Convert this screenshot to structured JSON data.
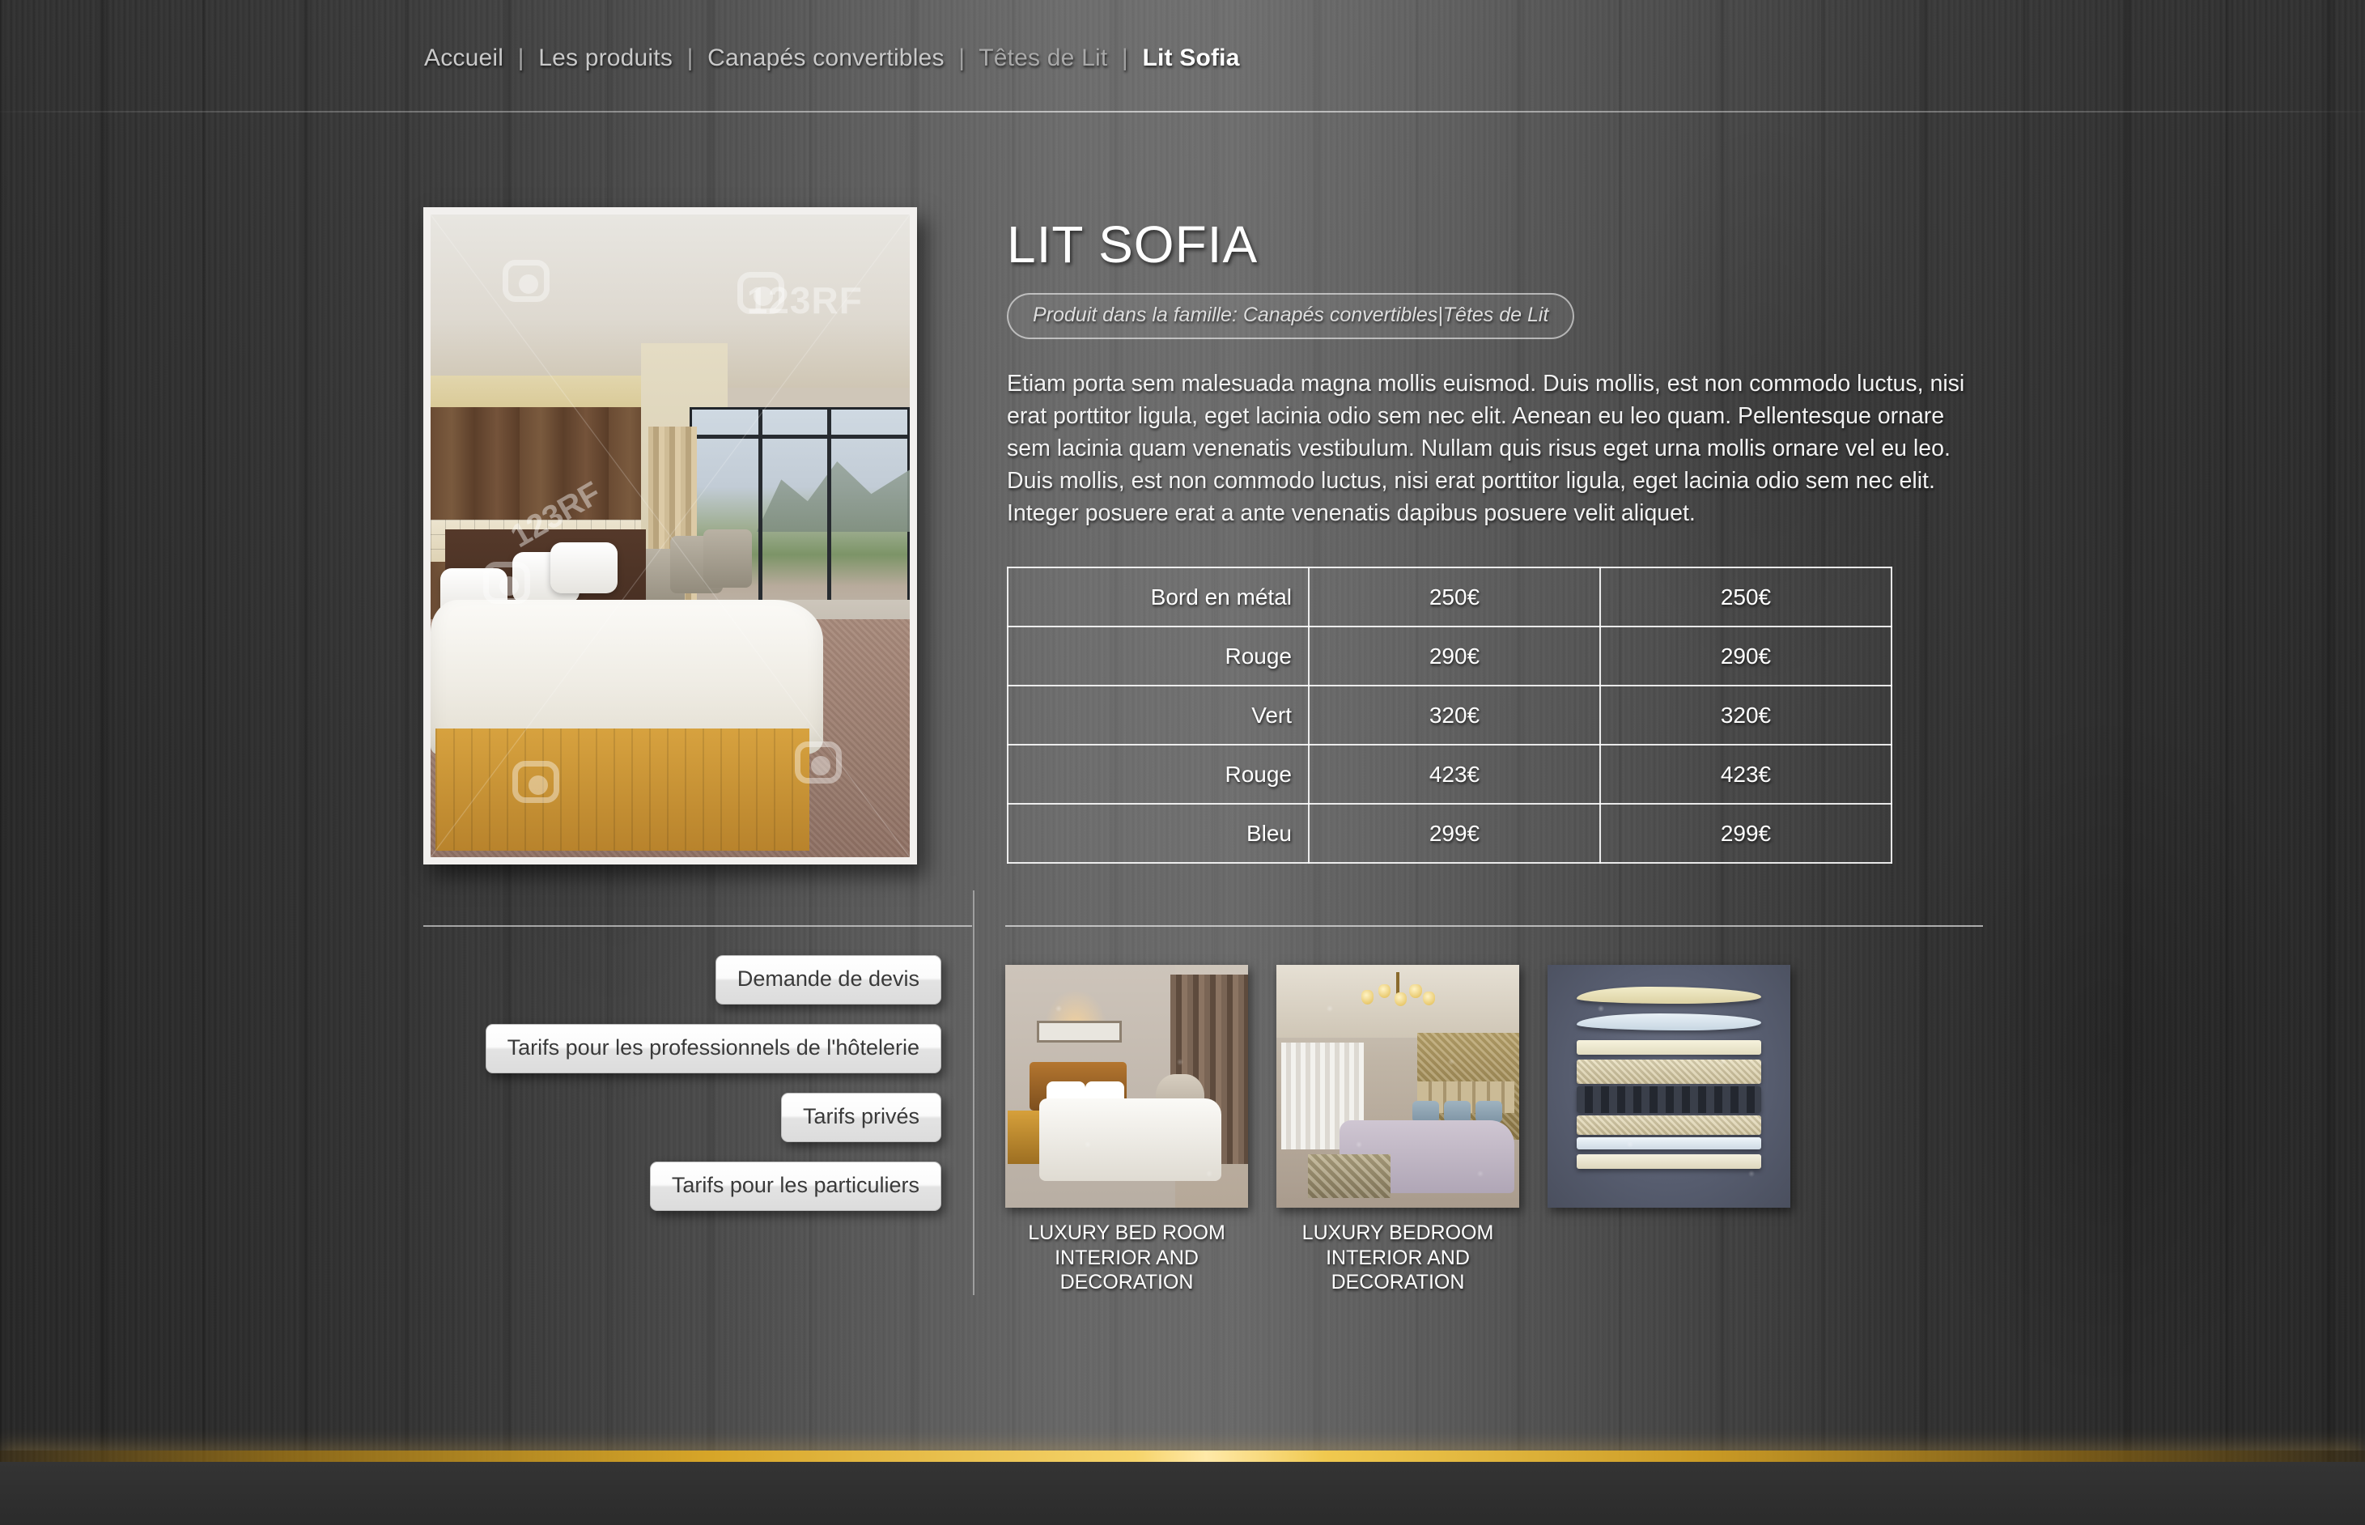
{
  "breadcrumb": {
    "items": [
      {
        "label": "Accueil",
        "current": false
      },
      {
        "label": "Les produits",
        "current": false
      },
      {
        "label": "Canapés convertibles",
        "current": false
      },
      {
        "label": "Têtes de Lit",
        "current": false
      },
      {
        "label": "Lit Sofia",
        "current": true
      }
    ],
    "separator": "|"
  },
  "product": {
    "title": "LIT SOFIA",
    "family_badge": "Produit dans la famille: Canapés convertibles|Têtes de Lit",
    "description": "Etiam porta sem malesuada magna mollis euismod. Duis mollis, est non commodo luctus, nisi erat porttitor ligula, eget lacinia odio sem nec elit. Aenean eu leo quam. Pellentesque ornare sem lacinia quam venenatis vestibulum. Nullam quis risus eget urna mollis ornare vel eu leo. Duis mollis, est non commodo luctus, nisi erat porttitor ligula, eget lacinia odio sem nec elit. Integer posuere erat a ante venenatis dapibus posuere velit aliquet.",
    "hero_image": {
      "name": "hotel-bedroom-photo",
      "watermark": "123RF"
    }
  },
  "price_table": {
    "rows": [
      {
        "label": "Bord en métal",
        "price_a": "250€",
        "price_b": "250€"
      },
      {
        "label": "Rouge",
        "price_a": "290€",
        "price_b": "290€"
      },
      {
        "label": "Vert",
        "price_a": "320€",
        "price_b": "320€"
      },
      {
        "label": "Rouge",
        "price_a": "423€",
        "price_b": "423€"
      },
      {
        "label": "Bleu",
        "price_a": "299€",
        "price_b": "299€"
      }
    ]
  },
  "cta_buttons": [
    {
      "label": "Demande de devis"
    },
    {
      "label": "Tarifs pour les professionnels de l'hôtelerie"
    },
    {
      "label": "Tarifs privés"
    },
    {
      "label": "Tarifs pour les particuliers"
    }
  ],
  "gallery": [
    {
      "caption": "LUXURY BED ROOM INTERIOR AND DECORATION",
      "image_name": "luxury-bed-room-thumbnail"
    },
    {
      "caption": "LUXURY BEDROOM INTERIOR AND DECORATION",
      "image_name": "luxury-bedroom-chandelier-thumbnail"
    },
    {
      "caption": "",
      "image_name": "mattress-layers-thumbnail"
    }
  ],
  "colors": {
    "background": "#2e2e2e",
    "footer_accent": "#f6d46a",
    "text_primary": "#ffffff",
    "text_muted": "#c9c9c9",
    "button_face": "#ffffff"
  }
}
